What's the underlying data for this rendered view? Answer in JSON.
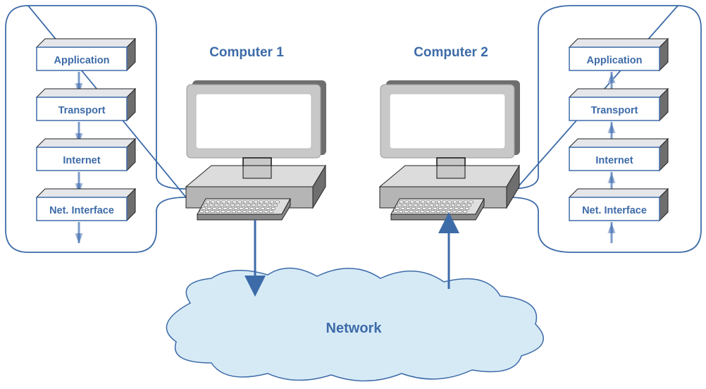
{
  "computers": [
    {
      "title": "Computer 1",
      "direction": "down"
    },
    {
      "title": "Computer 2",
      "direction": "up"
    }
  ],
  "stacks": [
    {
      "layers": [
        "Application",
        "Transport",
        "Internet",
        "Net. Interface"
      ],
      "flow": "down"
    },
    {
      "layers": [
        "Application",
        "Transport",
        "Internet",
        "Net. Interface"
      ],
      "flow": "up"
    }
  ],
  "network": {
    "label": "Network"
  },
  "colors": {
    "accent": "#3d6ba8",
    "cloud": "#d6eaf6",
    "box_side": "#6e6e6e",
    "monitor": "#c8c8c8"
  }
}
